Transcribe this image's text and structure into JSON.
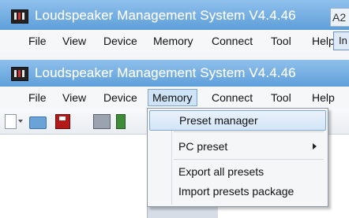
{
  "app": {
    "title": "Loudspeaker Management System V4.4.46"
  },
  "menubar": {
    "items": [
      "File",
      "View",
      "Device",
      "Memory",
      "Connect",
      "Tool",
      "Help"
    ],
    "active": "Memory"
  },
  "memory_menu": {
    "items": [
      {
        "label": "Preset manager",
        "highlighted": true
      },
      {
        "label": "PC preset",
        "has_submenu": true
      },
      {
        "label": "Export all presets"
      },
      {
        "label": "Import presets package"
      }
    ]
  },
  "side_panel": {
    "tab_text": "A2",
    "button_text": "In"
  },
  "colors": {
    "titlebar": "#6aa6df",
    "highlight": "#d3e5f8",
    "accent_border": "#7aa7d8"
  },
  "icons": [
    "new-file-icon",
    "dropdown-arrow-icon",
    "open-folder-icon",
    "save-icon",
    "print-icon",
    "device-chip-icon"
  ]
}
